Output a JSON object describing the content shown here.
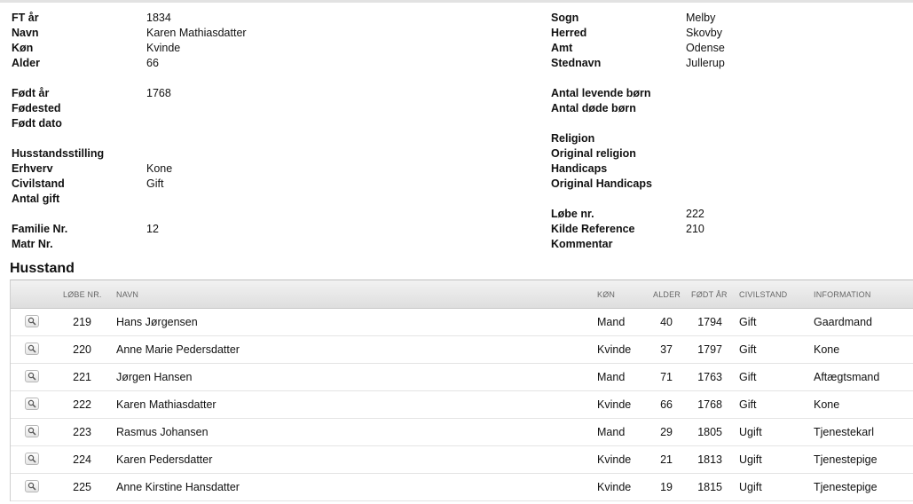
{
  "left_fields": [
    {
      "label": "FT år",
      "value": "1834"
    },
    {
      "label": "Navn",
      "value": "Karen Mathiasdatter"
    },
    {
      "label": "Køn",
      "value": "Kvinde"
    },
    {
      "label": "Alder",
      "value": "66"
    },
    null,
    {
      "label": "Født år",
      "value": "1768"
    },
    {
      "label": "Fødested",
      "value": ""
    },
    {
      "label": "Født dato",
      "value": ""
    },
    null,
    {
      "label": "Husstandsstilling",
      "value": ""
    },
    {
      "label": "Erhverv",
      "value": "Kone"
    },
    {
      "label": "Civilstand",
      "value": "Gift"
    },
    {
      "label": "Antal gift",
      "value": ""
    },
    null,
    {
      "label": "Familie Nr.",
      "value": "12"
    },
    {
      "label": "Matr Nr.",
      "value": ""
    }
  ],
  "right_fields": [
    {
      "label": "Sogn",
      "value": "Melby"
    },
    {
      "label": "Herred",
      "value": "Skovby"
    },
    {
      "label": "Amt",
      "value": "Odense"
    },
    {
      "label": "Stednavn",
      "value": "Jullerup"
    },
    null,
    {
      "label": "Antal levende børn",
      "value": ""
    },
    {
      "label": "Antal døde børn",
      "value": ""
    },
    null,
    {
      "label": "Religion",
      "value": ""
    },
    {
      "label": "Original religion",
      "value": ""
    },
    {
      "label": "Handicaps",
      "value": ""
    },
    {
      "label": "Original Handicaps",
      "value": ""
    },
    null,
    {
      "label": "Løbe nr.",
      "value": "222"
    },
    {
      "label": "Kilde Reference",
      "value": "210"
    },
    {
      "label": "Kommentar",
      "value": ""
    }
  ],
  "household": {
    "title": "Husstand",
    "columns": {
      "lobe_nr": "LØBE NR.",
      "navn": "NAVN",
      "kon": "KØN",
      "alder": "ALDER",
      "fodt_ar": "FØDT ÅR",
      "civilstand": "CIVILSTAND",
      "information": "INFORMATION"
    },
    "rows": [
      {
        "lobe_nr": "219",
        "navn": "Hans Jørgensen",
        "kon": "Mand",
        "alder": "40",
        "fodt_ar": "1794",
        "civilstand": "Gift",
        "information": "Gaardmand"
      },
      {
        "lobe_nr": "220",
        "navn": "Anne Marie Pedersdatter",
        "kon": "Kvinde",
        "alder": "37",
        "fodt_ar": "1797",
        "civilstand": "Gift",
        "information": "Kone"
      },
      {
        "lobe_nr": "221",
        "navn": "Jørgen Hansen",
        "kon": "Mand",
        "alder": "71",
        "fodt_ar": "1763",
        "civilstand": "Gift",
        "information": "Aftægtsmand"
      },
      {
        "lobe_nr": "222",
        "navn": "Karen Mathiasdatter",
        "kon": "Kvinde",
        "alder": "66",
        "fodt_ar": "1768",
        "civilstand": "Gift",
        "information": "Kone"
      },
      {
        "lobe_nr": "223",
        "navn": "Rasmus Johansen",
        "kon": "Mand",
        "alder": "29",
        "fodt_ar": "1805",
        "civilstand": "Ugift",
        "information": "Tjenestekarl"
      },
      {
        "lobe_nr": "224",
        "navn": "Karen Pedersdatter",
        "kon": "Kvinde",
        "alder": "21",
        "fodt_ar": "1813",
        "civilstand": "Ugift",
        "information": "Tjenestepige"
      },
      {
        "lobe_nr": "225",
        "navn": "Anne Kirstine Hansdatter",
        "kon": "Kvinde",
        "alder": "19",
        "fodt_ar": "1815",
        "civilstand": "Ugift",
        "information": "Tjenestepige"
      }
    ]
  }
}
